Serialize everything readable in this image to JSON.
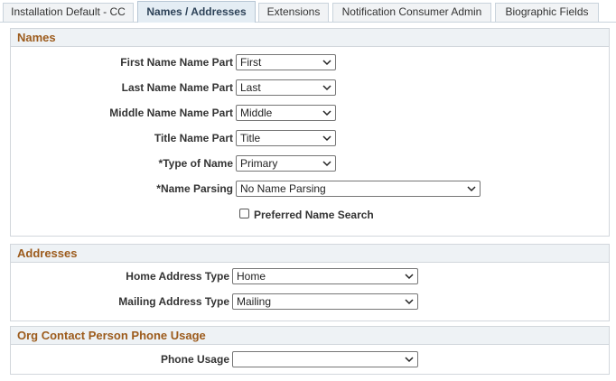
{
  "tabs": [
    {
      "label": "Installation Default - CC",
      "active": false
    },
    {
      "label": "Names / Addresses",
      "active": true
    },
    {
      "label": "Extensions",
      "active": false
    },
    {
      "label": "Notification Consumer Admin",
      "active": false
    },
    {
      "label": "Biographic Fields",
      "active": false
    }
  ],
  "names": {
    "header": "Names",
    "first": {
      "label": "First Name Name Part",
      "value": "First"
    },
    "last": {
      "label": "Last Name Name Part",
      "value": "Last"
    },
    "middle": {
      "label": "Middle Name Name Part",
      "value": "Middle"
    },
    "title": {
      "label": "Title Name Part",
      "value": "Title"
    },
    "type": {
      "label": "*Type of Name",
      "value": "Primary"
    },
    "parsing": {
      "label": "*Name Parsing",
      "value": "No Name Parsing"
    },
    "preferred": {
      "label": "Preferred Name Search",
      "checked": false
    }
  },
  "addresses": {
    "header": "Addresses",
    "home": {
      "label": "Home Address Type",
      "value": "Home"
    },
    "mailing": {
      "label": "Mailing Address Type",
      "value": "Mailing"
    }
  },
  "org": {
    "header": "Org Contact Person Phone Usage",
    "phone": {
      "label": "Phone Usage",
      "value": ""
    }
  },
  "icons": {
    "dropdown": "chevron-down-icon"
  }
}
